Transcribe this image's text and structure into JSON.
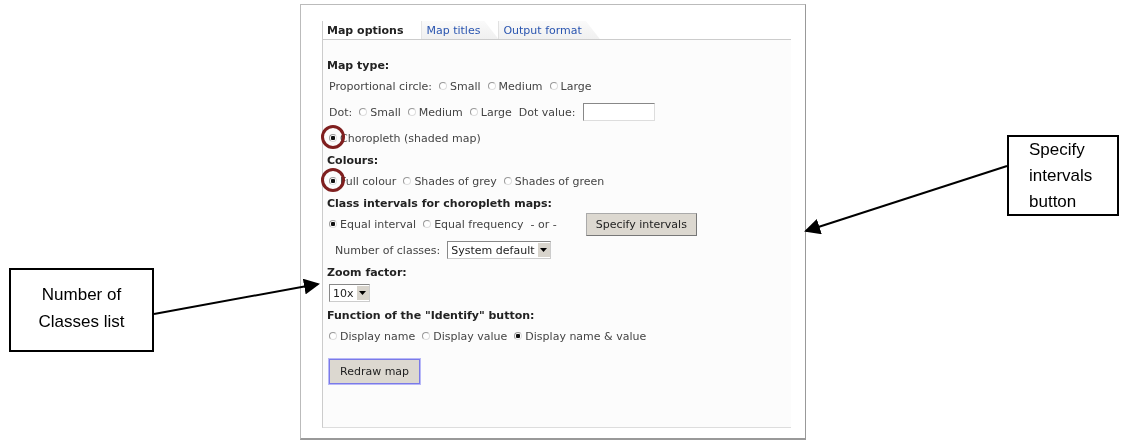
{
  "tabs": [
    {
      "label": "Map options",
      "selected": true
    },
    {
      "label": "Map titles",
      "selected": false
    },
    {
      "label": "Output format",
      "selected": false
    }
  ],
  "sections": [
    {
      "heading": "Map type:",
      "rows": [
        {
          "items": [
            {
              "kind": "label",
              "text": "Proportional circle:"
            },
            {
              "kind": "radio",
              "label": "Small",
              "selected": false
            },
            {
              "kind": "radio",
              "label": "Medium",
              "selected": false
            },
            {
              "kind": "radio",
              "label": "Large",
              "selected": false
            }
          ]
        },
        {
          "items": [
            {
              "kind": "label",
              "text": "Dot:"
            },
            {
              "kind": "radio",
              "label": "Small",
              "selected": false
            },
            {
              "kind": "radio",
              "label": "Medium",
              "selected": false
            },
            {
              "kind": "radio",
              "label": "Large",
              "selected": false
            },
            {
              "kind": "label",
              "text": "Dot value:"
            },
            {
              "kind": "input"
            }
          ]
        },
        {
          "items": [
            {
              "kind": "radio",
              "label": "Choropleth (shaded map)",
              "selected": true,
              "highlighted": true
            }
          ]
        }
      ]
    },
    {
      "heading": "Colours:",
      "rows": [
        {
          "items": [
            {
              "kind": "radio",
              "label": "Full colour",
              "selected": true,
              "highlighted": true
            },
            {
              "kind": "radio",
              "label": "Shades of grey",
              "selected": false
            },
            {
              "kind": "radio",
              "label": "Shades of green",
              "selected": false
            }
          ]
        }
      ]
    },
    {
      "heading": "Class intervals for choropleth maps:",
      "rows": [
        {
          "items": [
            {
              "kind": "radio",
              "label": "Equal interval",
              "selected": true
            },
            {
              "kind": "radio",
              "label": "Equal frequency",
              "selected": false
            },
            {
              "kind": "label",
              "text": "- or -"
            },
            {
              "kind": "button",
              "label": "Specify intervals"
            }
          ]
        },
        {
          "items": [
            {
              "kind": "label",
              "text": "Number of classes:"
            },
            {
              "kind": "select",
              "value": "System default"
            }
          ]
        }
      ]
    },
    {
      "heading": "Zoom factor:",
      "rows": [
        {
          "items": [
            {
              "kind": "select",
              "value": "10x"
            }
          ]
        }
      ]
    },
    {
      "heading": "Function of the \"Identify\" button:",
      "rows": [
        {
          "items": [
            {
              "kind": "radio",
              "label": "Display name",
              "selected": false
            },
            {
              "kind": "radio",
              "label": "Display value",
              "selected": false
            },
            {
              "kind": "radio",
              "label": "Display name & value",
              "selected": true
            }
          ]
        }
      ]
    }
  ],
  "redraw_button": "Redraw map",
  "callouts": [
    {
      "text": "Number of Classes list"
    },
    {
      "text": "Specify intervals button"
    }
  ]
}
